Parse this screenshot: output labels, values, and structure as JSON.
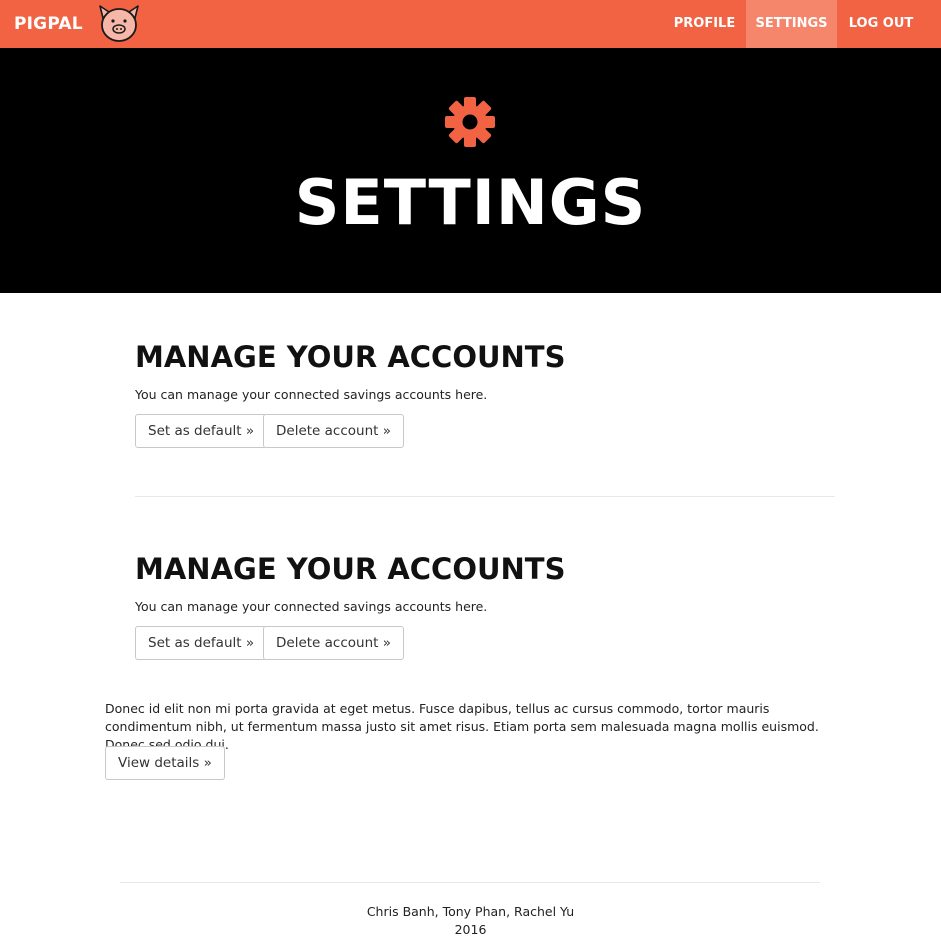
{
  "navbar": {
    "brand": "PIGPAL",
    "logo_icon": "pig-face-icon",
    "items": [
      {
        "label": "PROFILE",
        "active": false
      },
      {
        "label": "SETTINGS",
        "active": true
      },
      {
        "label": "LOG OUT",
        "active": false
      }
    ],
    "bg_color": "#f26344",
    "active_color": "#f5866b"
  },
  "hero": {
    "icon": "gear-icon",
    "title": "SETTINGS",
    "bg_color": "#000000",
    "icon_color": "#f26344"
  },
  "sections": [
    {
      "title": "MANAGE YOUR ACCOUNTS",
      "description": "You can manage your connected savings accounts here.",
      "buttons": [
        "Set as default »",
        "Delete account »"
      ]
    },
    {
      "title": "MANAGE YOUR ACCOUNTS",
      "description": "You can manage your connected savings accounts here.",
      "buttons": [
        "Set as default »",
        "Delete account »"
      ]
    }
  ],
  "info": {
    "paragraph": "Donec id elit non mi porta gravida at eget metus. Fusce dapibus, tellus ac cursus commodo, tortor mauris condimentum nibh, ut fermentum massa justo sit amet risus. Etiam porta sem malesuada magna mollis euismod. Donec sed odio dui.",
    "button": "View details »"
  },
  "footer": {
    "authors": "Chris Banh, Tony Phan, Rachel Yu",
    "year": "2016"
  }
}
